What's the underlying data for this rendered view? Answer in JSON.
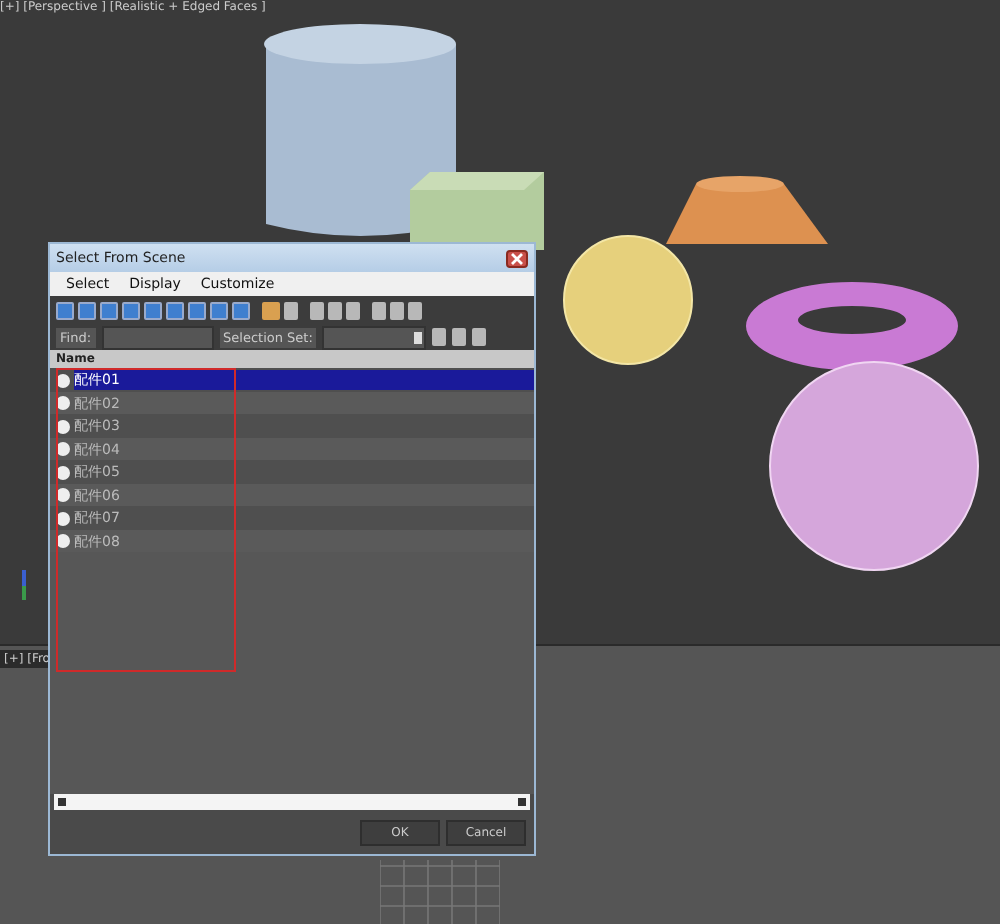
{
  "viewports": [
    {
      "label": "[+] [Perspective ] [Realistic + Edged Faces ]"
    },
    {
      "label": "[+] [Fro"
    }
  ],
  "dialog": {
    "title": "Select From Scene",
    "menu": [
      "Select",
      "Display",
      "Customize"
    ],
    "find_label": "Find:",
    "selection_set_label": "Selection Set:",
    "column": "Name",
    "rows": [
      {
        "name": "配件01",
        "selected": true
      },
      {
        "name": "配件02",
        "selected": false
      },
      {
        "name": "配件03",
        "selected": false
      },
      {
        "name": "配件04",
        "selected": false
      },
      {
        "name": "配件05",
        "selected": false
      },
      {
        "name": "配件06",
        "selected": false
      },
      {
        "name": "配件07",
        "selected": false
      },
      {
        "name": "配件08",
        "selected": false
      }
    ],
    "buttons": [
      "OK",
      "Cancel"
    ]
  }
}
